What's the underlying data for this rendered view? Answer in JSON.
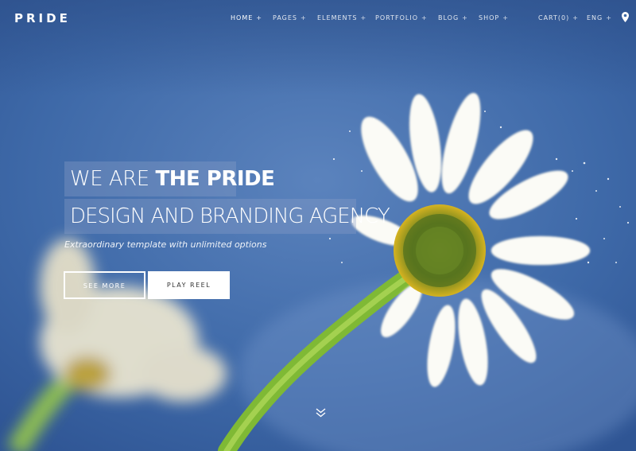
{
  "brand": {
    "logo_text": "PRIDE"
  },
  "nav": {
    "items": [
      {
        "label": "HOME",
        "suffix": "+"
      },
      {
        "label": "PAGES",
        "suffix": "+"
      },
      {
        "label": "ELEMENTS",
        "suffix": "+"
      },
      {
        "label": "PORTFOLIO",
        "suffix": "+"
      },
      {
        "label": "BLOG",
        "suffix": "+"
      },
      {
        "label": "SHOP",
        "suffix": "+"
      },
      {
        "label": "CART(0)",
        "suffix": "+"
      },
      {
        "label": "ENG",
        "suffix": "+"
      }
    ],
    "location_icon": "map-pin-icon"
  },
  "hero": {
    "headline_line1_regular": "WE ARE",
    "headline_line1_bold": "THE PRIDE",
    "headline_line2": "DESIGN AND BRANDING AGENCY",
    "tagline": "Extraordinary template with unlimited options",
    "primary_button": "SEE MORE",
    "secondary_button": "PLAY REEL",
    "scroll_icon": "double-chevron-down-icon"
  },
  "colors": {
    "sky": "#3f6aa6",
    "petal": "#ffffff",
    "stem": "#8cc63f",
    "center": "#4f6b1f"
  }
}
